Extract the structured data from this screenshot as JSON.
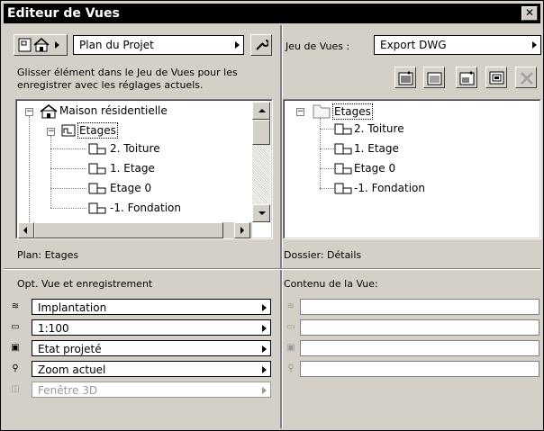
{
  "window": {
    "title": "Editeur de Vues",
    "close_glyph": "✕"
  },
  "left": {
    "source_popup": "Plan du Projet",
    "instruction": "Glisser élément dans le Jeu de Vues pour les enregistrer avec les réglages actuels.",
    "tree": [
      {
        "label": "Maison résidentielle",
        "icon": "house-icon",
        "toggle": "−"
      },
      {
        "label": "Etages",
        "icon": "floors-icon",
        "toggle": "−"
      },
      {
        "label": "2. Toiture",
        "icon": "floor-plan-icon"
      },
      {
        "label": "1. Etage",
        "icon": "floor-plan-icon"
      },
      {
        "label": "Etage 0",
        "icon": "floor-plan-icon"
      },
      {
        "label": "-1. Fondation",
        "icon": "floor-plan-icon"
      }
    ],
    "status": "Plan: Etages"
  },
  "right": {
    "set_label": "Jeu de Vues :",
    "set_popup": "Export DWG",
    "tree": [
      {
        "label": "Etages",
        "icon": "folder-icon",
        "toggle": "−"
      },
      {
        "label": "2. Toiture",
        "icon": "floor-plan-icon"
      },
      {
        "label": "1. Etage",
        "icon": "floor-plan-icon"
      },
      {
        "label": "Etage 0",
        "icon": "floor-plan-icon"
      },
      {
        "label": "-1. Fondation",
        "icon": "floor-plan-icon"
      }
    ],
    "status": "Dossier: Détails"
  },
  "options": {
    "title": "Opt. Vue et enregistrement",
    "rows": [
      {
        "icon": "layers-icon",
        "glyph": "≋",
        "value": "Implantation",
        "enabled": true
      },
      {
        "icon": "scale-icon",
        "glyph": "▭",
        "value": "1:100",
        "enabled": true
      },
      {
        "icon": "structure-icon",
        "glyph": "▣",
        "value": "Etat projeté",
        "enabled": true
      },
      {
        "icon": "zoom-icon",
        "glyph": "⚲",
        "value": "Zoom actuel",
        "enabled": true
      },
      {
        "icon": "3d-window-icon",
        "glyph": "◫",
        "value": "Fenêtre 3D",
        "enabled": false
      }
    ]
  },
  "content": {
    "title": "Contenu de la Vue:",
    "rows": [
      {
        "icon": "layers-icon",
        "glyph": "≋",
        "value": ""
      },
      {
        "icon": "scale-icon",
        "glyph": "▭",
        "value": ""
      },
      {
        "icon": "structure-icon",
        "glyph": "▣",
        "value": ""
      },
      {
        "icon": "zoom-icon",
        "glyph": "⚲",
        "value": ""
      }
    ]
  },
  "colors": {
    "title_bg": "#000000",
    "face": "#d4d0c8",
    "disabled": "#9a9a9a"
  }
}
